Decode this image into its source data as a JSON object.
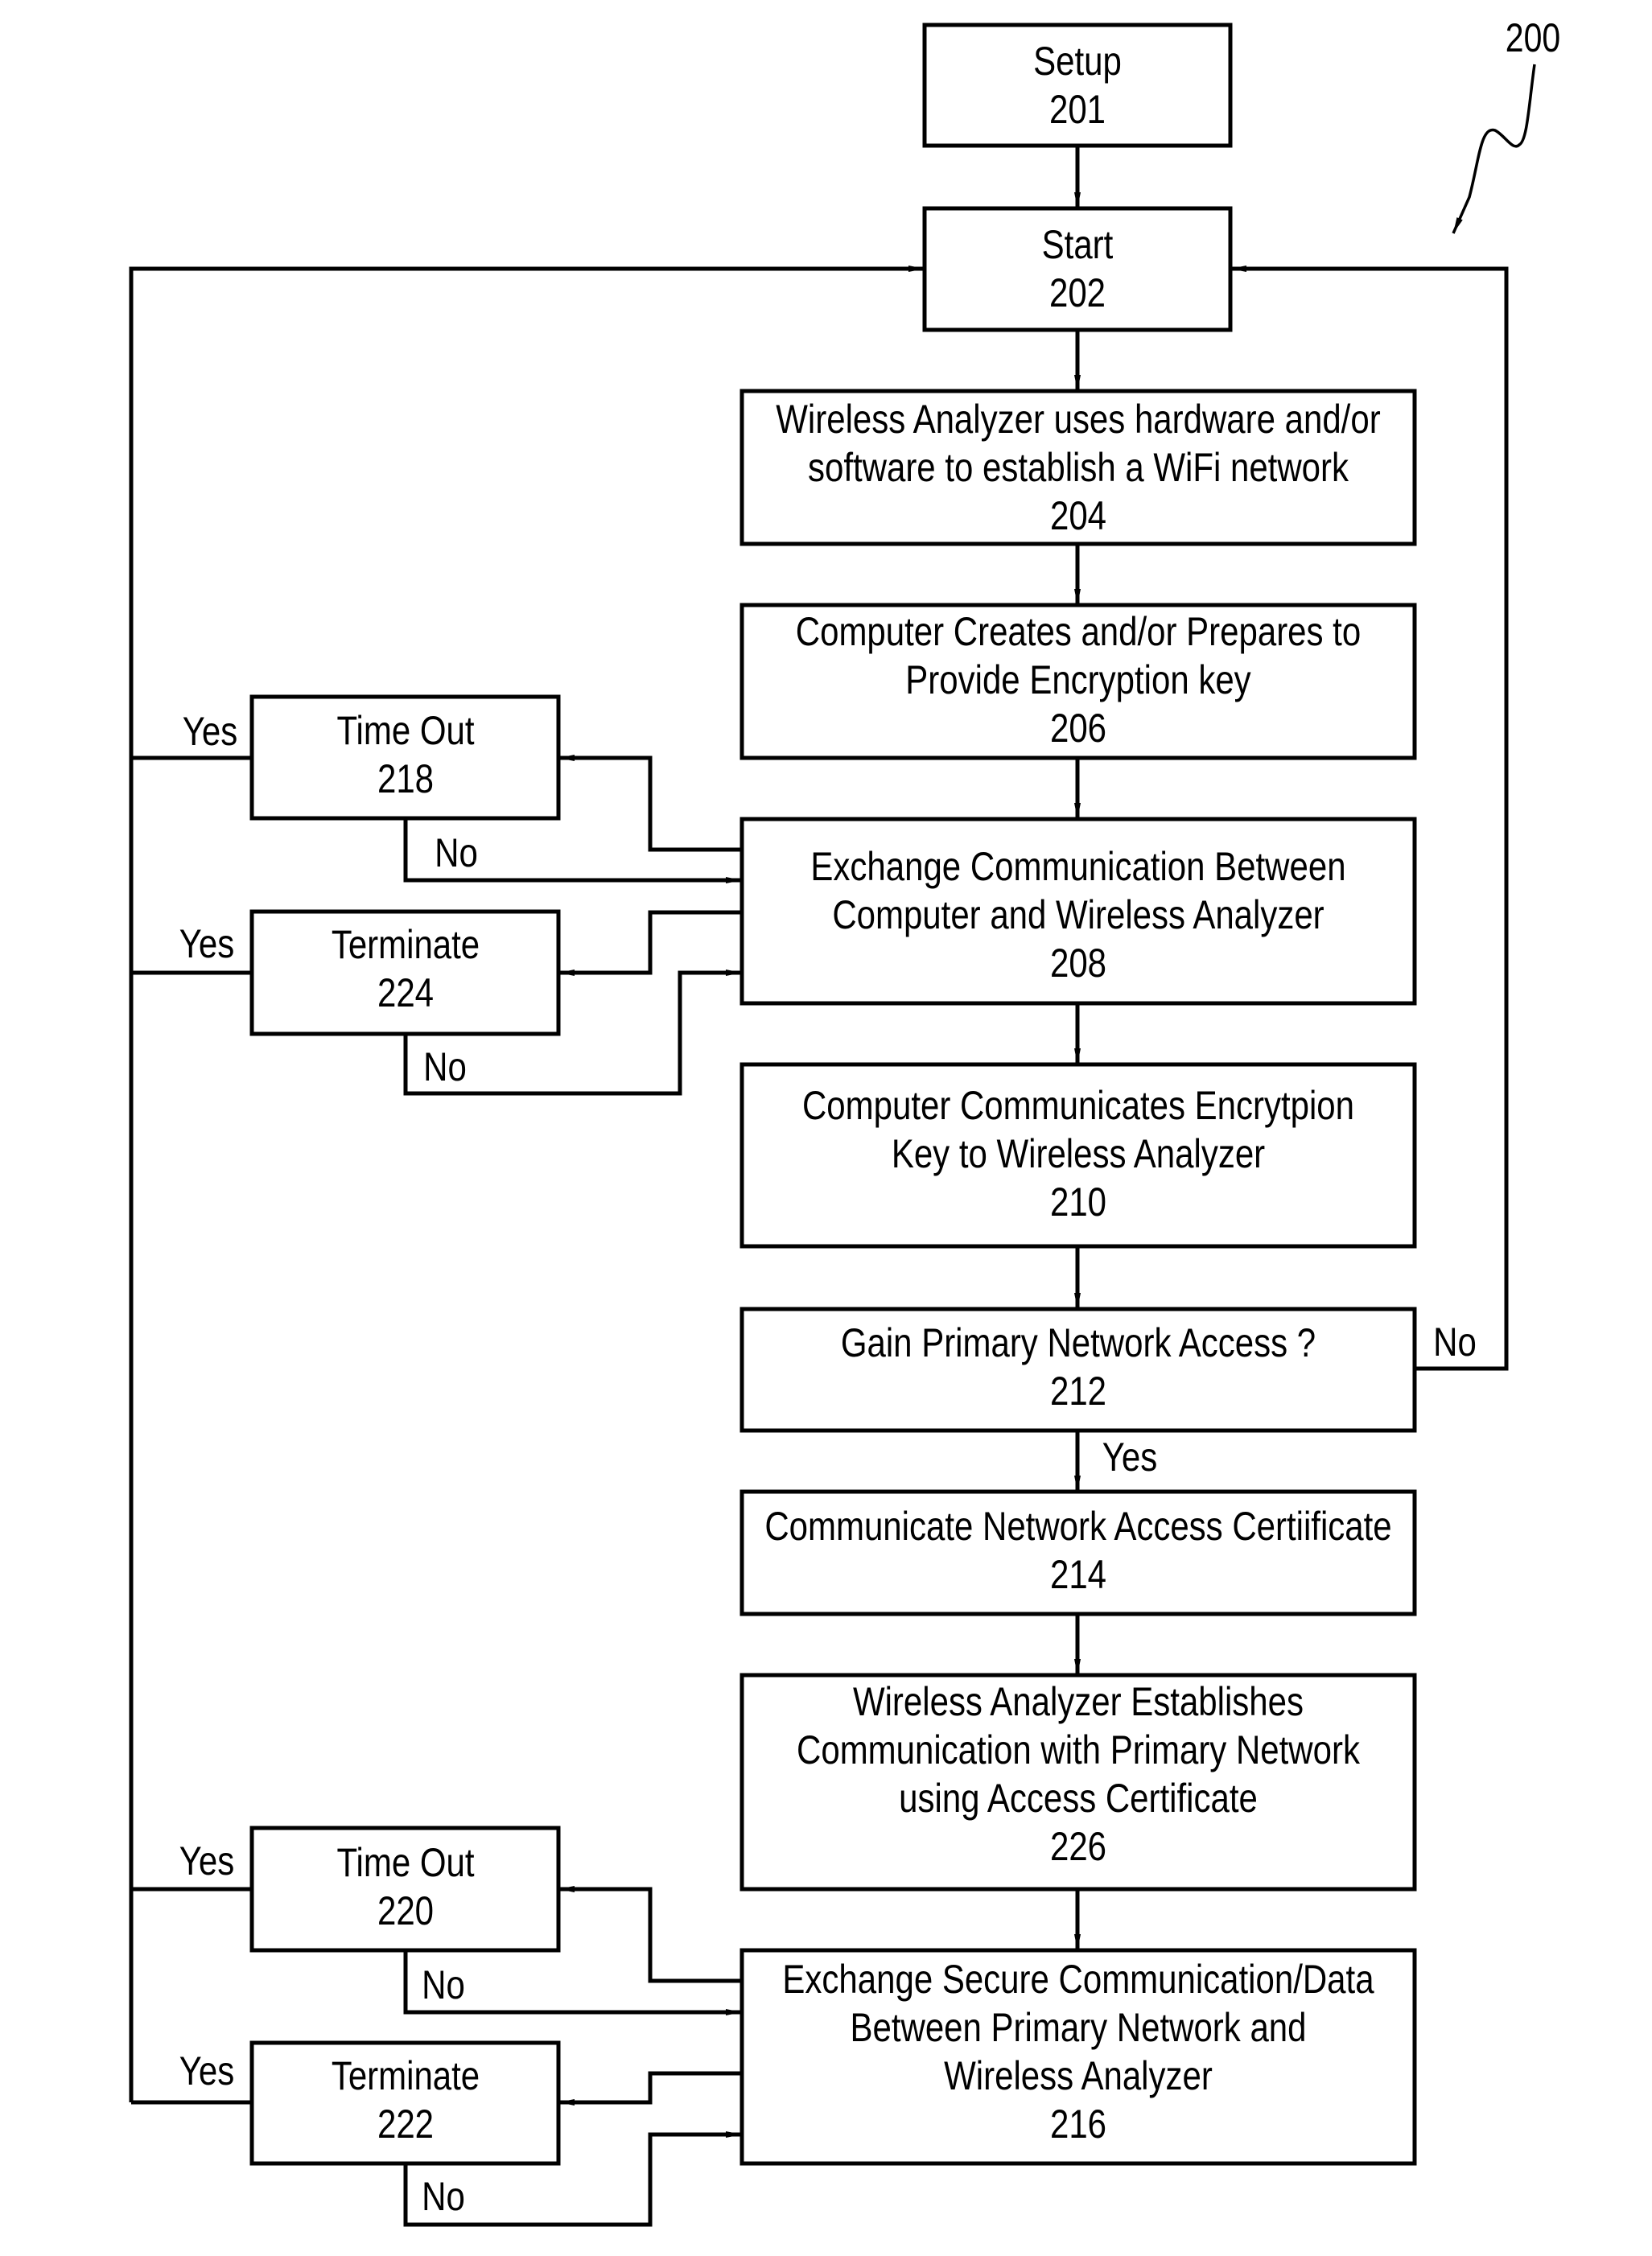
{
  "figure": {
    "reference_label": "200",
    "line_color": "#000000",
    "background_color": "#ffffff"
  },
  "nodes": {
    "n201": {
      "lines": [
        "Setup",
        "201"
      ]
    },
    "n202": {
      "lines": [
        "Start",
        "202"
      ]
    },
    "n204": {
      "lines": [
        "Wireless Analyzer uses hardware and/or",
        "software to establish a WiFi network",
        "204"
      ]
    },
    "n206": {
      "lines": [
        "Computer Creates and/or Prepares to",
        "Provide Encryption key",
        "206"
      ]
    },
    "n208": {
      "lines": [
        "Exchange Communication Between",
        "Computer and Wireless Analyzer",
        "208"
      ]
    },
    "n210": {
      "lines": [
        "Computer Communicates Encrytpion",
        "Key to Wireless Analyzer",
        "210"
      ]
    },
    "n212": {
      "lines": [
        "Gain Primary Network Access ?",
        "212"
      ]
    },
    "n214": {
      "lines": [
        "Communicate Network Access Certiificate",
        "214"
      ]
    },
    "n226": {
      "lines": [
        "Wireless Analyzer Establishes",
        "Communication with Primary Network",
        "using Access Certificate",
        "226"
      ]
    },
    "n216": {
      "lines": [
        "Exchange Secure Communication/Data",
        "Between Primary Network and",
        "Wireless Analyzer",
        "216"
      ]
    },
    "n218": {
      "lines": [
        "Time Out",
        "218"
      ]
    },
    "n224": {
      "lines": [
        "Terminate",
        "224"
      ]
    },
    "n220": {
      "lines": [
        "Time Out",
        "220"
      ]
    },
    "n222": {
      "lines": [
        "Terminate",
        "222"
      ]
    }
  },
  "edge_labels": {
    "yes_218": "Yes",
    "no_218": "No",
    "yes_224": "Yes",
    "no_224": "No",
    "no_212": "No",
    "yes_212": "Yes",
    "yes_220": "Yes",
    "no_220": "No",
    "yes_222": "Yes",
    "no_222": "No"
  }
}
